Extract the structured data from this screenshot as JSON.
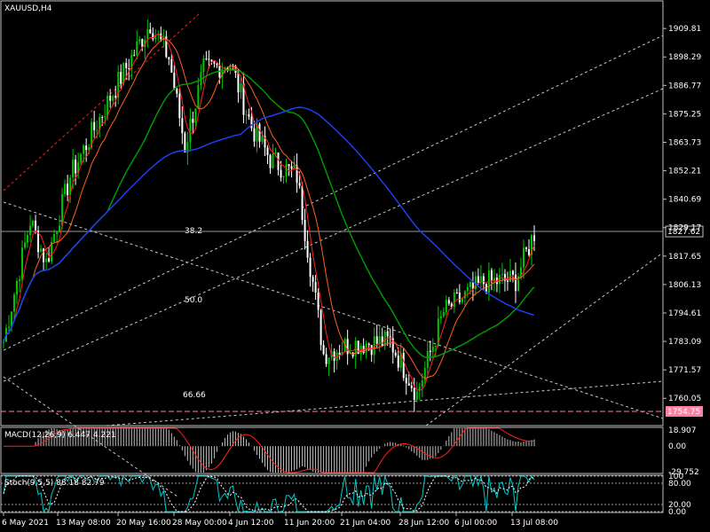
{
  "chart_data": {
    "type": "candlestick",
    "title": "XAUUSD,H4",
    "symbol": "XAUUSD",
    "timeframe": "H4",
    "ylim": [
      1749.0,
      1921.0
    ],
    "y_ticks": [
      "1909.81",
      "1898.29",
      "1886.77",
      "1875.25",
      "1863.73",
      "1852.21",
      "1840.69",
      "1829.17",
      "1817.65",
      "1806.13",
      "1794.61",
      "1783.09",
      "1771.57",
      "1760.05"
    ],
    "x_ticks": [
      "6 May 2021",
      "13 May 08:00",
      "20 May 16:00",
      "28 May 00:00",
      "4 Jun 12:00",
      "11 Jun 20:00",
      "21 Jun 04:00",
      "28 Jun 12:00",
      "6 Jul 00:00",
      "13 Jul 08:00"
    ],
    "current_price": "1827.62",
    "horizontal_level": "1754.75",
    "fib_labels": [
      "38.2",
      "50.0",
      "66.66"
    ],
    "bars": 200,
    "price_path": [
      {
        "i": 0,
        "p": 1783
      },
      {
        "i": 10,
        "p": 1832
      },
      {
        "i": 16,
        "p": 1815
      },
      {
        "i": 25,
        "p": 1850
      },
      {
        "i": 40,
        "p": 1882
      },
      {
        "i": 55,
        "p": 1912
      },
      {
        "i": 62,
        "p": 1898
      },
      {
        "i": 68,
        "p": 1862
      },
      {
        "i": 75,
        "p": 1893
      },
      {
        "i": 85,
        "p": 1896
      },
      {
        "i": 93,
        "p": 1870
      },
      {
        "i": 100,
        "p": 1857
      },
      {
        "i": 110,
        "p": 1850
      },
      {
        "i": 120,
        "p": 1778
      },
      {
        "i": 130,
        "p": 1782
      },
      {
        "i": 145,
        "p": 1783
      },
      {
        "i": 155,
        "p": 1762
      },
      {
        "i": 165,
        "p": 1795
      },
      {
        "i": 180,
        "p": 1807
      },
      {
        "i": 192,
        "p": 1808
      },
      {
        "i": 199,
        "p": 1827
      }
    ],
    "series": [
      {
        "name": "MACD(12,26,9)",
        "values": [
          "6.447",
          "4.221"
        ]
      },
      {
        "name": "Stoch(9,5,5)",
        "values": [
          "88.18",
          "82.79"
        ]
      }
    ],
    "macd": {
      "label": "MACD(12,26,9) 6.447 4.221",
      "ticks": [
        "18.907",
        "0.00",
        "-29.752"
      ],
      "ylim": [
        -31,
        21
      ]
    },
    "stoch": {
      "label": "Stoch(9,5,5) 88.18 82.79",
      "ticks": [
        "100",
        "80.00",
        "20.00",
        "0.00"
      ],
      "ylim": [
        0,
        100
      ]
    },
    "colors": {
      "bull": "#00c800",
      "bear": "#ffffff",
      "ma_fast": "#ff2020",
      "ma_mid": "#ff6020",
      "ma_slow": "#00a000",
      "ma_long": "#2040ff",
      "trend": "#c8c8c8",
      "level": "#ff80a0",
      "grid": "#505050"
    }
  }
}
